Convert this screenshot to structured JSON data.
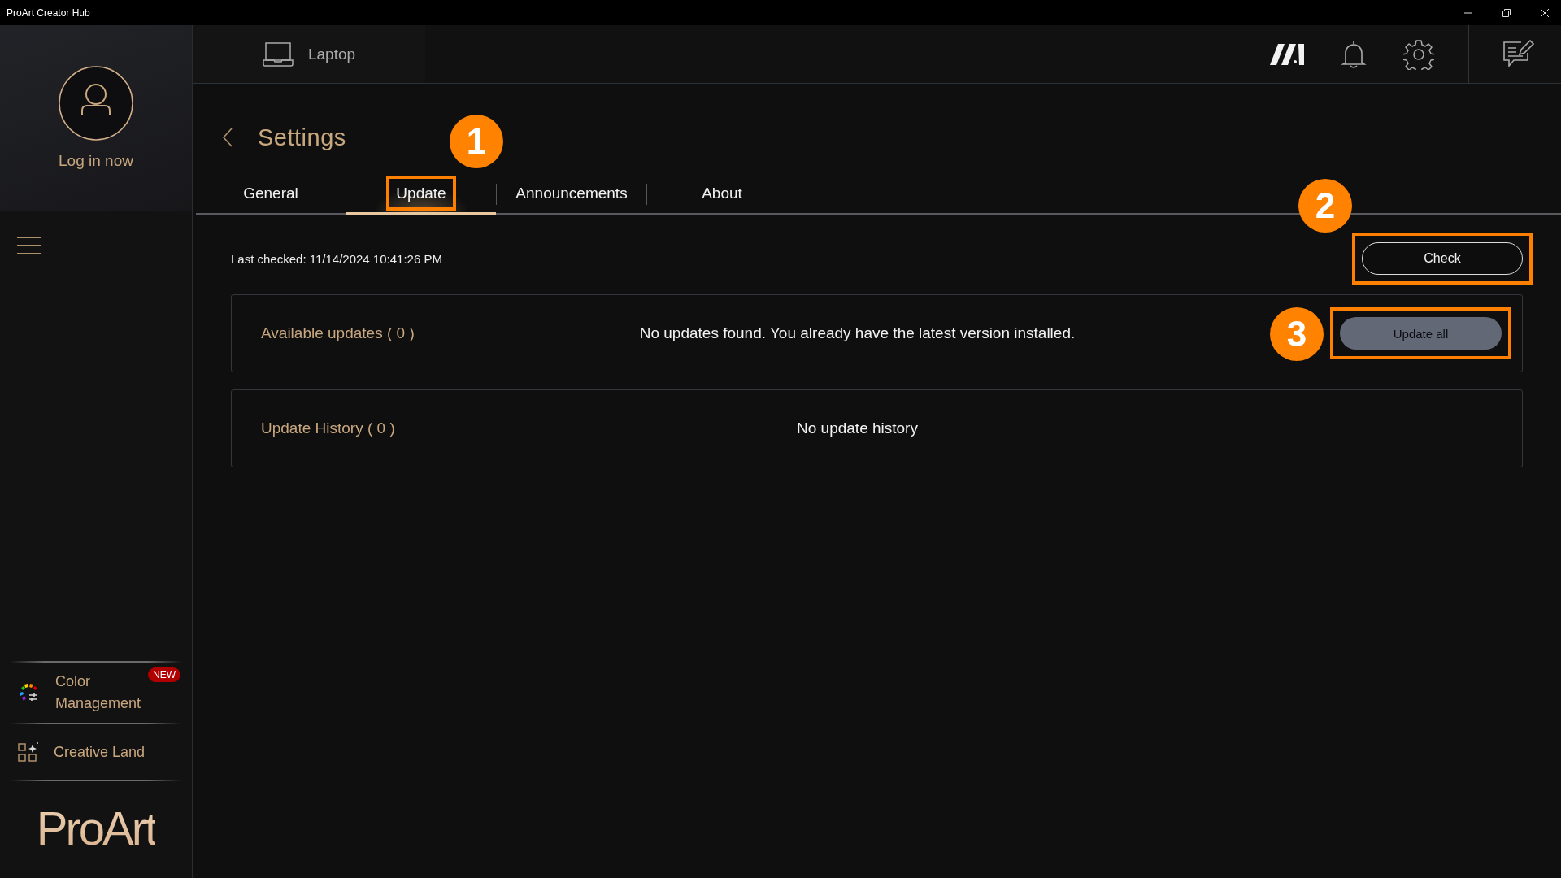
{
  "title_bar": {
    "title": "ProArt Creator Hub"
  },
  "sidebar": {
    "login_label": "Log in now",
    "items": [
      {
        "kind": "color-management",
        "label": "Color Management",
        "badge": "NEW"
      },
      {
        "kind": "creative-land",
        "label": "Creative Land"
      }
    ],
    "logo": "ProArt"
  },
  "device_tab": {
    "label": "Laptop"
  },
  "page": {
    "title": "Settings",
    "tabs": [
      {
        "label": "General",
        "selected": false,
        "highlighted": false
      },
      {
        "label": "Update",
        "selected": true,
        "highlighted": true,
        "annotation": "1"
      },
      {
        "label": "Announcements",
        "selected": false,
        "highlighted": false
      },
      {
        "label": "About",
        "selected": false,
        "highlighted": false
      }
    ],
    "last_checked": "Last checked: 11/14/2024 10:41:26 PM",
    "check_button": {
      "label": "Check",
      "highlighted": true,
      "annotation": "2"
    },
    "sections": [
      {
        "title": "Available updates ( 0 )",
        "message": "No updates found. You already have the latest version installed.",
        "button": {
          "label": "Update all",
          "disabled": true,
          "highlighted": true,
          "annotation": "3"
        }
      },
      {
        "title": "Update History ( 0 )",
        "message": "No update history"
      }
    ]
  }
}
